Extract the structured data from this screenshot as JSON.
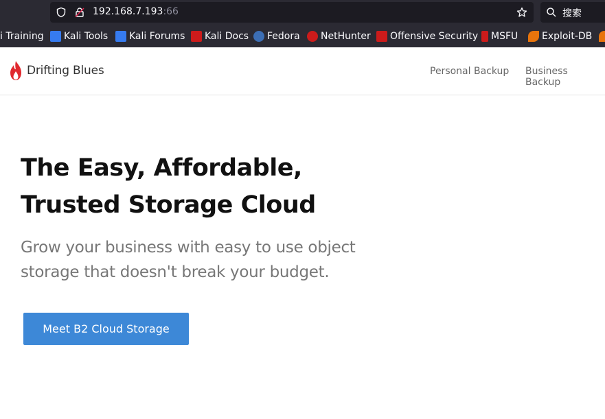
{
  "browser": {
    "url_host": "192.168.7.193",
    "url_port": ":66",
    "search_placeholder": "搜索",
    "bookmarks": [
      {
        "label": "i Training",
        "color": "#2b2a33"
      },
      {
        "label": "Kali Tools",
        "color": "#367bf0"
      },
      {
        "label": "Kali Forums",
        "color": "#367bf0"
      },
      {
        "label": "Kali Docs",
        "color": "#cc1b1b"
      },
      {
        "label": "Fedora",
        "color": "#3c6eb4"
      },
      {
        "label": "NetHunter",
        "color": "#cc1b1b"
      },
      {
        "label": "Offensive Security",
        "color": "#cc1b1b"
      },
      {
        "label": "MSFU",
        "color": "#cc1b1b"
      },
      {
        "label": "Exploit-DB",
        "color": "#e8740c"
      }
    ]
  },
  "site": {
    "brand": "Drifting Blues",
    "brand_color": "#e0282e",
    "nav": [
      "Personal Backup",
      "Business Backup"
    ],
    "hero_title_line1": "The Easy, Affordable,",
    "hero_title_line2": "Trusted Storage Cloud",
    "hero_subtitle_line1": "Grow your business with easy to use object",
    "hero_subtitle_line2": "storage that doesn't break your budget.",
    "cta_label": "Meet B2 Cloud Storage",
    "cta_color": "#3d88d7"
  }
}
